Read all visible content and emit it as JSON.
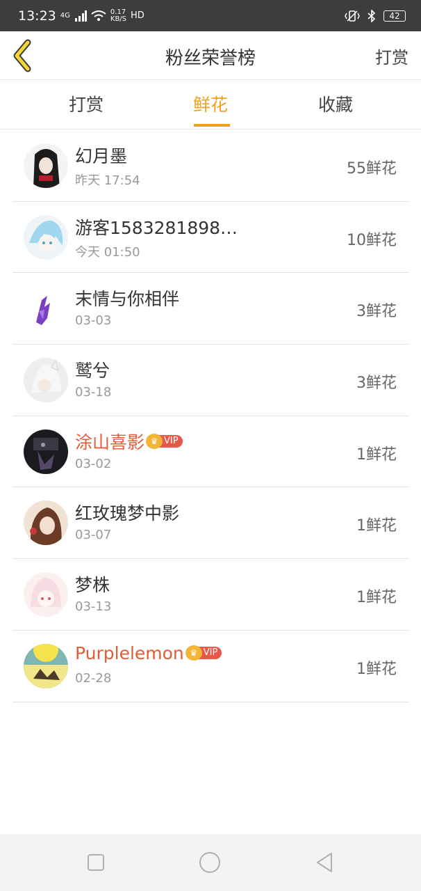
{
  "status_bar": {
    "time": "13:23",
    "network": "4G",
    "speed_value": "0.17",
    "speed_unit": "KB/S",
    "hd": "HD",
    "battery": "42"
  },
  "header": {
    "title": "粉丝荣誉榜",
    "action_label": "打赏"
  },
  "tabs": [
    {
      "label": "打赏",
      "active": false
    },
    {
      "label": "鲜花",
      "active": true
    },
    {
      "label": "收藏",
      "active": false
    }
  ],
  "fans": [
    {
      "name": "幻月墨",
      "time": "昨天 17:54",
      "amount": "55鲜花",
      "vip": false
    },
    {
      "name": "游客1583281898…",
      "time": "今天 01:50",
      "amount": "10鲜花",
      "vip": false
    },
    {
      "name": "末情与你相伴",
      "time": "03-03",
      "amount": "3鲜花",
      "vip": false
    },
    {
      "name": "鹫兮",
      "time": "03-18",
      "amount": "3鲜花",
      "vip": false
    },
    {
      "name": "涂山喜影",
      "time": "03-02",
      "amount": "1鲜花",
      "vip": true,
      "vip_label": "VIP"
    },
    {
      "name": "红玫瑰梦中影",
      "time": "03-07",
      "amount": "1鲜花",
      "vip": false
    },
    {
      "name": "梦株",
      "time": "03-13",
      "amount": "1鲜花",
      "vip": false
    },
    {
      "name": "Purplelemon",
      "time": "02-28",
      "amount": "1鲜花",
      "vip": true,
      "vip_label": "VIP"
    }
  ],
  "colors": {
    "accent": "#f0a020",
    "vip_name": "#e65a35",
    "vip_badge": "#e8584a",
    "status_bar": "#3d3d3d"
  }
}
